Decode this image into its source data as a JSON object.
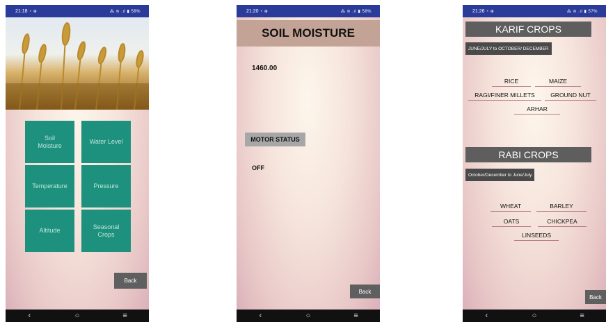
{
  "screens": [
    {
      "status_time": "21:18",
      "status_icons": "◔ ⊕",
      "status_right": "⁂ ≋ .ıl ▮ 58%",
      "tiles": [
        "Soil\nMoisture",
        "Water Level",
        "Temperature",
        "Pressure",
        "Altitude",
        "Seasonal\nCrops"
      ],
      "back": "Back"
    },
    {
      "status_time": "21:20",
      "status_icons": "◔ ⊕",
      "status_right": "⁂ ≋ .ıl ▮ 58%",
      "title": "SOIL MOISTURE",
      "value": "1460.00",
      "motor_label": "MOTOR STATUS",
      "motor_value": "OFF",
      "back": "Back"
    },
    {
      "status_time": "21:26",
      "status_icons": "◔ ⊕",
      "status_right": "⁂ ≋ .ıl ▮ 57%",
      "karif_title": "KARIF CROPS",
      "karif_range": "JUNE/JULY to OCTOBER/ DECEMBER",
      "karif_crops": [
        "RICE",
        "MAIZE",
        "RAGI/FINER MILLETS",
        "GROUND NUT",
        "ARHAR"
      ],
      "rabi_title": "RABI CROPS",
      "rabi_range": "October/December to June/July",
      "rabi_crops": [
        "WHEAT",
        "BARLEY",
        "OATS",
        "CHICKPEA",
        "LINSEEDS"
      ],
      "back": "Back"
    }
  ],
  "nav": {
    "back_icon": "‹",
    "home_icon": "○",
    "menu_icon": "≡"
  },
  "colors": {
    "status_bar": "#2b3b9a",
    "tile": "#1d917d",
    "title_band": "#c3a396",
    "header": "#5e5e5e"
  }
}
